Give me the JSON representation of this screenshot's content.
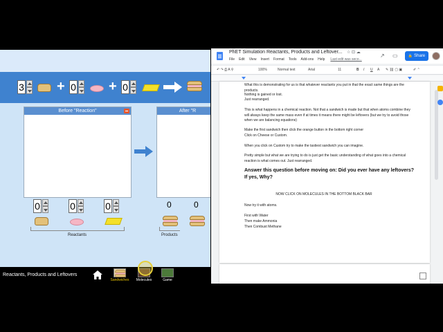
{
  "sim": {
    "equation": {
      "coefficients": [
        "3",
        "0",
        "0"
      ],
      "plus": "+",
      "items": [
        "bread-icon",
        "ham-icon",
        "cheese-icon"
      ],
      "product": "sandwich-icon"
    },
    "before_panel_title": "Before \"Reaction\"",
    "after_panel_title": "After \"R",
    "reactant_counts": [
      "0",
      "0",
      "0"
    ],
    "product_counts": [
      "0",
      "0"
    ],
    "reactants_label": "Reactants",
    "products_label": "Products",
    "footer": {
      "title": "Reactants, Products and Leftovers",
      "nav": [
        {
          "label": "Sandwiches",
          "active": true,
          "color": "#e6c200"
        },
        {
          "label": "Molecules",
          "active": false,
          "color": "#ffffff"
        },
        {
          "label": "Game",
          "active": false,
          "color": "#ffffff"
        }
      ]
    }
  },
  "docs": {
    "title": "PhET Simulation Reactants, Products and Leftover...",
    "menu": [
      "File",
      "Edit",
      "View",
      "Insert",
      "Format",
      "Tools",
      "Add-ons",
      "Help"
    ],
    "last_edit": "Last edit was seco...",
    "share_label": "Share",
    "toolbar": {
      "zoom": "100%",
      "style": "Normal text",
      "font": "Arial",
      "size": "11",
      "bold": "B",
      "italic": "I",
      "underline": "U",
      "text_color": "A"
    },
    "paragraphs": [
      "What this is demonstrating for us is that whatever reactants you put in that the exact same things are the products.",
      "Nothing is gained or lost.",
      "Just rearranged.",
      "This is what happens in a chemical reaction. Not that a sandwich is made but that when atoms combine they will always keep the same mass even if at times it means there might be leftovers (but we try to avoid those when we are balancing equations)",
      "Make the first sandwich then click the orange button in the bottom right corner",
      "Click on Cheese or Custom.",
      "When you click on Custom try to make the tastiest sandwich you can imagine.",
      "Pretty simple but what we are trying to do is just get the basic understanding of what goes into a chemical reaction is what comes out. Just rearranged.",
      "Answer this question before moving on: Did you ever have any leftovers? If yes, Why?",
      "NOW CLICK ON MOLECULES IN THE BOTTOM BLACK BAR",
      "Now try it with atoms.",
      "First with Water",
      "Then make Ammonia",
      "Then Combust Methane"
    ]
  }
}
